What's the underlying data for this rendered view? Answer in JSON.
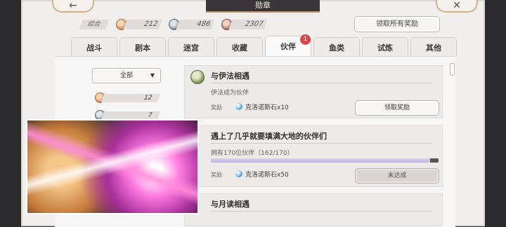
{
  "window": {
    "title": "勋章"
  },
  "nav": {
    "back_icon": "←",
    "close_icon": "✕"
  },
  "summary": {
    "label": "综合",
    "items": [
      {
        "medal": "gold-medal-icon",
        "value": "212"
      },
      {
        "medal": "silver-medal-icon",
        "value": "486"
      },
      {
        "medal": "bronze-medal-icon",
        "value": "2307"
      }
    ],
    "claim_all_label": "领取所有奖励"
  },
  "tabs": [
    {
      "label": "战斗"
    },
    {
      "label": "剧本"
    },
    {
      "label": "迷宫"
    },
    {
      "label": "收藏"
    },
    {
      "label": "伙伴",
      "active": true,
      "badge": "1"
    },
    {
      "label": "鱼类"
    },
    {
      "label": "试炼"
    },
    {
      "label": "其他"
    }
  ],
  "filter": {
    "selected": "全部",
    "caret": "▼",
    "counts": [
      {
        "medal": "gold-medal-icon",
        "value": "12"
      },
      {
        "medal": "silver-medal-icon",
        "value": "7"
      }
    ]
  },
  "cards": [
    {
      "title": "与伊法相遇",
      "desc": "伊法成为伙伴",
      "reward_label": "奖励",
      "reward": "克洛诺斯石x10",
      "button": "领取奖励",
      "button_state": "enabled"
    },
    {
      "title": "遇上了几乎就要填满大地的伙伴们",
      "desc": "拥有170位伙伴（162/170）",
      "progress": 0.953,
      "reward_label": "奖励",
      "reward": "克洛诺斯石x50",
      "button": "未达成",
      "button_state": "disabled"
    },
    {
      "title": "与月读相遇"
    }
  ],
  "colors": {
    "badge": "#d24a4a",
    "progress_fill": "#b9b0e4",
    "title_bar": "#3a3538"
  }
}
